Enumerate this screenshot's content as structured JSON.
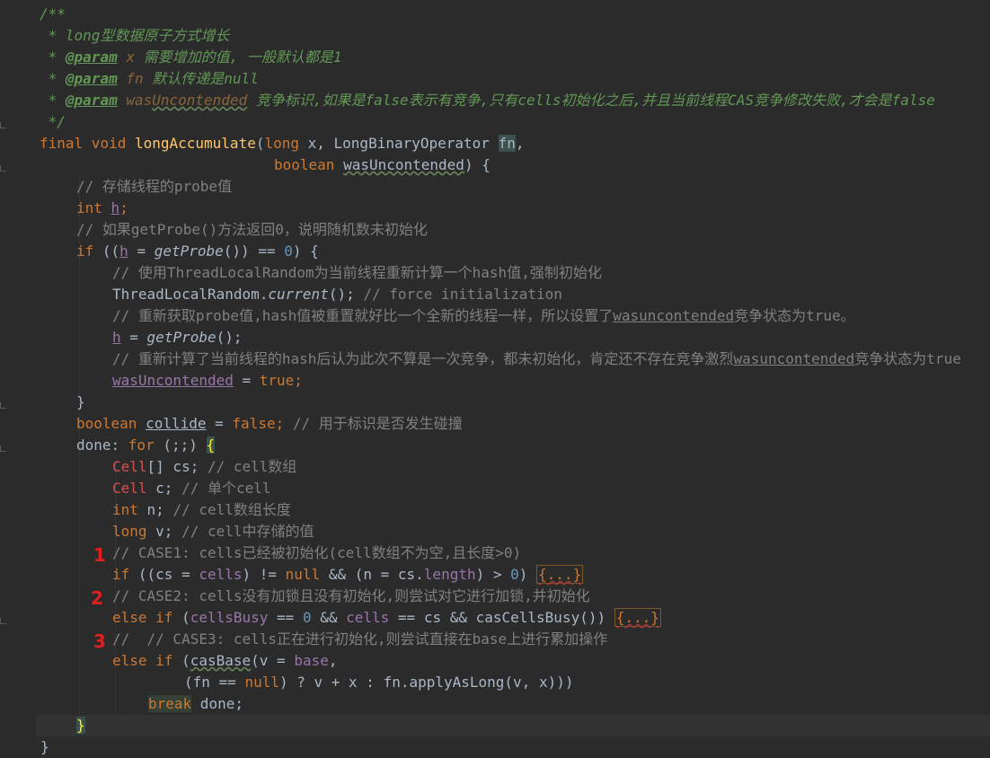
{
  "code": {
    "javadoc_open": "/**",
    "doc_title": " * long型数据原子方式增长",
    "doc_star": " * ",
    "param_tag": "@param",
    "param1_name": "x",
    "param1_desc": " 需要增加的值, 一般默认都是1",
    "param2_name": "fn",
    "param2_desc": " 默认传递是null",
    "param3_name_a": "was",
    "param3_name_b": "Uncontended",
    "param3_desc_a": " 竞争标识,如果是",
    "param3_desc_false": "false",
    "param3_desc_b": "表示有竞争,只有",
    "param3_desc_cells": "cells",
    "param3_desc_c": "初始化之后,并且当前线程",
    "param3_desc_cas": "CAS",
    "param3_desc_d": "竞争修改失败,才会是",
    "param3_desc_false2": "false",
    "javadoc_close": " */",
    "sig_final": "final",
    "sig_void": " void ",
    "sig_name": "longAccumulate",
    "sig_p1": "(",
    "sig_long": "long",
    "sig_p2": " x, LongBinaryOperator ",
    "sig_fn": "fn",
    "sig_p3": ",",
    "sig2_boolean": "boolean",
    "sig2_sp": " ",
    "sig2_name": "wasUncontended",
    "sig2_end": ") {",
    "c_store_probe": "// 存储线程的probe值",
    "int_kw": "int",
    "h_var": "h",
    "semi": ";",
    "c_getprobe": "// 如果getProbe()方法返回0，说明随机数未初始化",
    "if_kw": "if",
    "if1_a": " ((",
    "if1_b": " = ",
    "getprobe": "getProbe",
    "if1_c": "()) == ",
    "zero": "0",
    "if1_d": ") {",
    "c_tlr": "// 使用ThreadLocalRandom为当前线程重新计算一个hash值,强制初始化",
    "tlr_a": "ThreadLocalRandom.",
    "tlr_current": "current",
    "tlr_b": "(); ",
    "c_force": "// force initialization",
    "c_reget": "// 重新获取probe值,hash值被重置就好比一个全新的线程一样，所以设置了",
    "c_reget_u": "wasuncontended",
    "c_reget_b": "竞争状态为true。",
    "h_assign_b": " = ",
    "h_assign_c": "();",
    "c_recalc": "// 重新计算了当前线程的hash后认为此次不算是一次竞争，都未初始化，肯定还不存在竞争激烈",
    "c_recalc_u": "wasuncontended",
    "c_recalc_b": "竞争状态为true",
    "wu_var": "wasUncontended",
    "wu_b": " = ",
    "true_kw": "true",
    "close_brace": "}",
    "boolean_kw": "boolean",
    "collide_var": "collide",
    "false_kw": "false",
    "c_collide": "// 用于标识是否发生碰撞",
    "done_label": "done: ",
    "for_kw": "for",
    "for_b": " (;;) ",
    "open_brace": "{",
    "cell_type": "Cell",
    "cs_decl": "[] cs; ",
    "c_cs": "// cell数组",
    "c_decl": " c; ",
    "c_c": "// 单个cell",
    "n_decl": " n; ",
    "c_n": "// cell数组长度",
    "long_kw": "long",
    "v_decl": " v; ",
    "c_v": "// cell中存储的值",
    "c_case1": "// CASE1: cells已经被初始化(cell数组不为空,且长度>0)",
    "if2_a": " ((cs = ",
    "cells_f": "cells",
    "if2_b": ") != ",
    "null_kw": "null",
    "if2_c": " && (n = cs.",
    "length_f": "length",
    "if2_d": ") > ",
    "if2_e": ") ",
    "folded": "{...}",
    "c_case2": "// CASE2: cells没有加锁且没有初始化,则尝试对它进行加锁,并初始化",
    "else_kw": "else",
    "elif_sp": " ",
    "cellsbusy_f": "cellsBusy",
    "elif_b": " == ",
    "elif_c": " && ",
    "elif_d": " == cs && casCellsBusy()) ",
    "c_case3": "//  // CASE3: cells正在进行初始化,则尝试直接在base上进行累加操作",
    "casbase": "casBase",
    "elif3_b": "(v = ",
    "base_f": "base",
    "elif3_c": ",",
    "line_fn_a": "(fn == ",
    "line_fn_b": ") ? v + x : fn.applyAsLong(v, x)))",
    "break_kw": "break",
    "break_b": " done;"
  },
  "markers": {
    "m1": "1",
    "m2": "2",
    "m3": "3"
  },
  "colors": {
    "background": "#2b2b2b",
    "keyword": "#cc7832",
    "function": "#ffc66d",
    "doc_comment": "#629755",
    "line_comment": "#808080",
    "number": "#6897bb",
    "field": "#9876aa",
    "marker": "#e02020"
  }
}
